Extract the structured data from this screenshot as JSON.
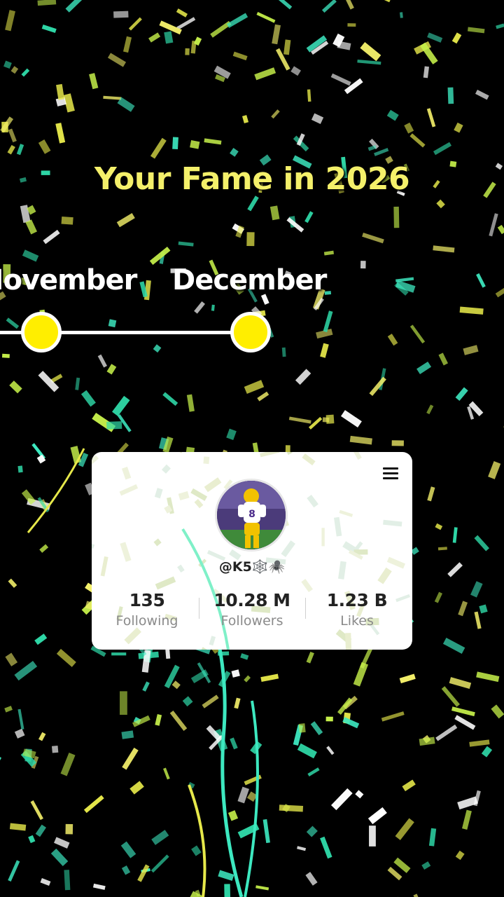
{
  "title": "Your Fame in 2026",
  "timeline": {
    "previous_month": "November",
    "current_month": "December"
  },
  "profile": {
    "username": "@K5🕸️🕷️",
    "stats": [
      {
        "value": "135",
        "label": "Following"
      },
      {
        "value": "10.28 M",
        "label": "Followers"
      },
      {
        "value": "1.23 B",
        "label": "Likes"
      }
    ]
  },
  "colors": {
    "background": "#000000",
    "title": "#f4f06a",
    "timeline_dot": "#ffee00",
    "confetti": [
      "#f4f06a",
      "#c6f04a",
      "#3de8c0",
      "#2fd9a8",
      "#ffffff",
      "#e6e84a"
    ]
  },
  "icons": {
    "menu": "hamburger-menu-icon"
  }
}
